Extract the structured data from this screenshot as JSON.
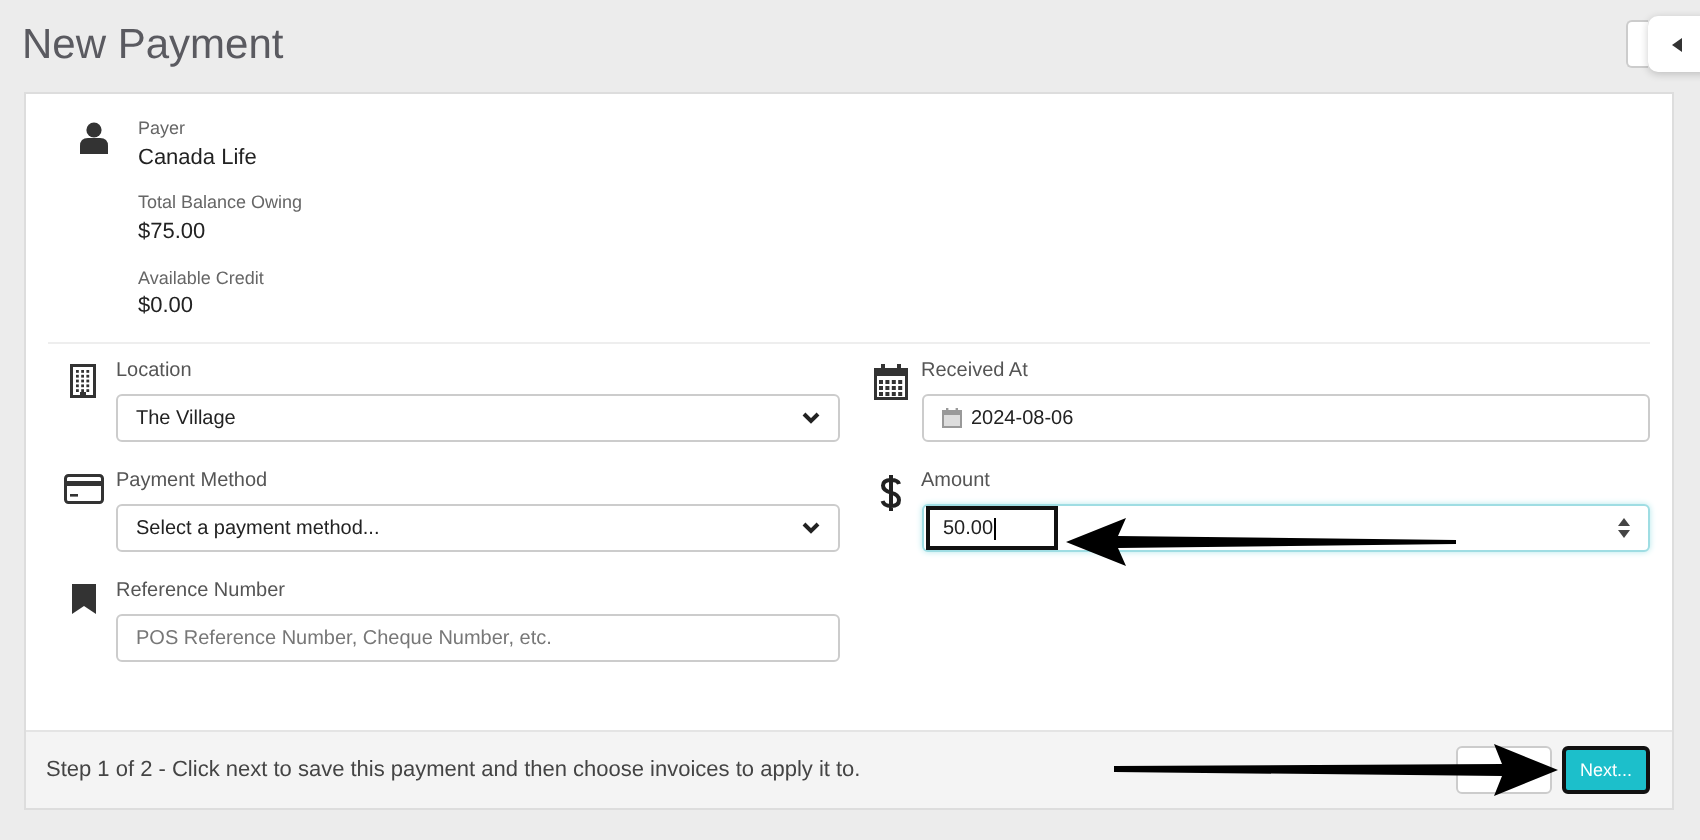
{
  "page": {
    "title": "New Payment"
  },
  "payer": {
    "label": "Payer",
    "name": "Canada Life",
    "balance_label": "Total Balance Owing",
    "balance": "$75.00",
    "credit_label": "Available Credit",
    "credit": "$0.00"
  },
  "columns": [
    {
      "fields": [
        {
          "kind": "select",
          "label": "Location",
          "value": "The Village"
        },
        {
          "kind": "select",
          "label": "Payment Method",
          "value": "Select a payment method..."
        },
        {
          "kind": "text",
          "label": "Reference Number",
          "placeholder": "POS Reference Number, Cheque Number, etc."
        }
      ]
    },
    {
      "fields": [
        {
          "kind": "date",
          "label": "Received At",
          "value": "2024-08-06"
        },
        {
          "kind": "number",
          "label": "Amount",
          "value": "50.00",
          "highlighted": true
        }
      ]
    }
  ],
  "footer": {
    "text": "Step 1 of 2 - Click next to save this payment and then choose invoices to apply it to.",
    "buttons": [
      {
        "kind": "blank",
        "highlighted": false
      },
      {
        "kind": "primary",
        "label": "Next...",
        "highlighted": true
      }
    ]
  }
}
